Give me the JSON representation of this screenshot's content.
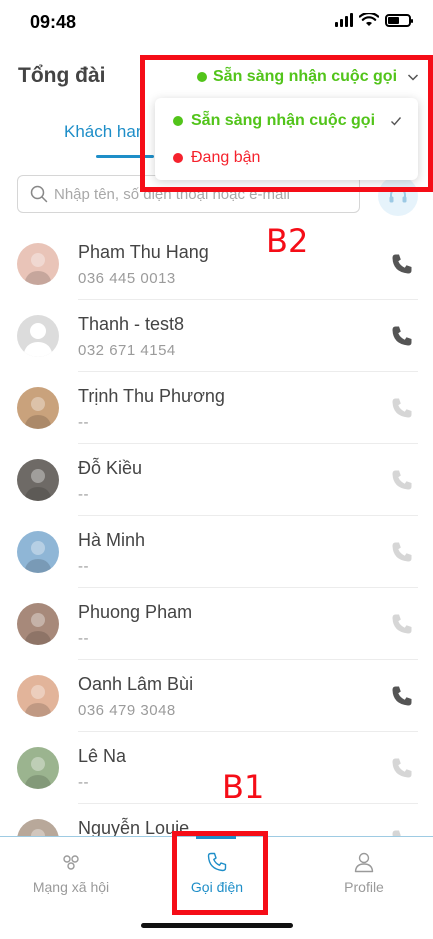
{
  "status_bar": {
    "time": "09:48"
  },
  "header": {
    "title": "Tổng đài",
    "status_label": "Sẵn sàng nhận cuộc gọi"
  },
  "tabs": [
    {
      "label": "Khách han"
    }
  ],
  "search": {
    "placeholder": "Nhập tên, số điện thoại hoặc e-mail"
  },
  "dropdown": {
    "options": [
      {
        "label": "Sẵn sàng nhận cuộc gọi",
        "selected": true,
        "color": "#52c41a"
      },
      {
        "label": "Đang bận",
        "selected": false,
        "color": "#f5222d"
      }
    ]
  },
  "contacts": [
    {
      "name": "Pham Thu Hang",
      "phone": "036 445 0013",
      "call_enabled": true
    },
    {
      "name": "Thanh - test8",
      "phone": "032 671 4154",
      "call_enabled": true
    },
    {
      "name": "Trịnh Thu Phương",
      "phone": "--",
      "call_enabled": false
    },
    {
      "name": "Đỗ Kiều",
      "phone": "--",
      "call_enabled": false
    },
    {
      "name": "Hà Minh",
      "phone": "--",
      "call_enabled": false
    },
    {
      "name": "Phuong Pham",
      "phone": "--",
      "call_enabled": false
    },
    {
      "name": "Oanh Lâm Bùi",
      "phone": "036 479 3048",
      "call_enabled": true
    },
    {
      "name": "Lê Na",
      "phone": "--",
      "call_enabled": false
    },
    {
      "name": "Nguyễn Louie",
      "phone": "",
      "call_enabled": false
    }
  ],
  "bottom_nav": [
    {
      "label": "Mạng xã hội",
      "icon": "social-icon",
      "active": false
    },
    {
      "label": "Gọi điện",
      "icon": "phone-icon",
      "active": true
    },
    {
      "label": "Profile",
      "icon": "person-icon",
      "active": false
    }
  ],
  "annotations": {
    "b1": "B1",
    "b2": "B2"
  },
  "colors": {
    "accent": "#1e8ec8",
    "ready": "#52c41a",
    "busy": "#f5222d",
    "annotation": "#f50d17"
  }
}
